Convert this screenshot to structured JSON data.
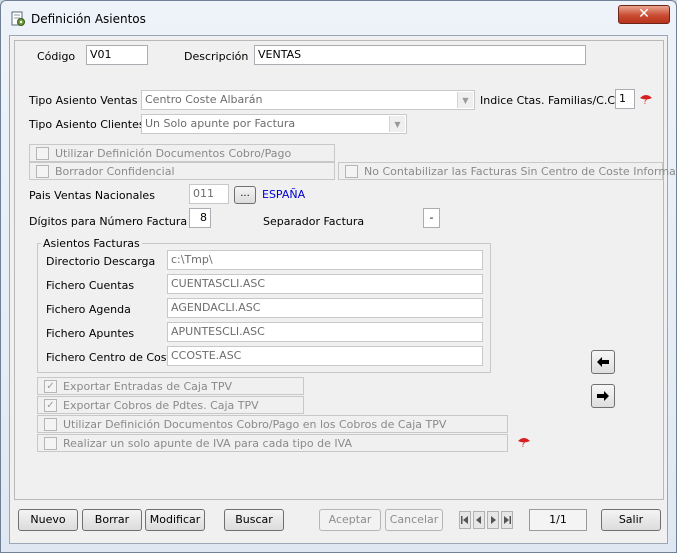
{
  "window": {
    "title": "Definición Asientos",
    "close_label": "✕"
  },
  "form": {
    "codigo_label": "Código",
    "codigo_value": "V01",
    "descripcion_label": "Descripción",
    "descripcion_value": "VENTAS",
    "tipo_ventas_label": "Tipo Asiento Ventas",
    "tipo_ventas_value": "Centro Coste Albarán",
    "indice_label": "Indice Ctas. Familias/C.Cost",
    "indice_value": "1",
    "tipo_clientes_label": "Tipo Asiento Clientes",
    "tipo_clientes_value": "Un Solo apunte por Factura",
    "utilizar_def_label": "Utilizar Definición Documentos Cobro/Pago",
    "borrador_label": "Borrador Confidencial",
    "no_contabilizar_label": "No Contabilizar las Facturas Sin Centro de Coste Informado",
    "pais_label": "Pais Ventas Nacionales",
    "pais_code": "011",
    "pais_browse_label": "...",
    "pais_name": "ESPAÑA",
    "digitos_label": "Dígitos para Número Factura",
    "digitos_value": "8",
    "separador_label": "Separador Factura",
    "separador_value": "-"
  },
  "asientos": {
    "group_title": "Asientos Facturas",
    "rows": [
      {
        "label": "Directorio Descarga",
        "value": "c:\\Tmp\\"
      },
      {
        "label": "Fichero Cuentas",
        "value": "CUENTASCLI.ASC"
      },
      {
        "label": "Fichero Agenda",
        "value": "AGENDACLI.ASC"
      },
      {
        "label": "Fichero Apuntes",
        "value": "APUNTESCLI.ASC"
      },
      {
        "label": "Fichero Centro de Coste",
        "value": "CCOSTE.ASC"
      }
    ]
  },
  "options": {
    "exportar_entradas": "Exportar Entradas de Caja TPV",
    "exportar_cobros": "Exportar Cobros de Pdtes. Caja TPV",
    "utilizar_def_tpv": "Utilizar Definición Documentos Cobro/Pago en los Cobros de Caja TPV",
    "realizar_apunte": "Realizar un solo apunte de IVA para cada tipo de IVA"
  },
  "toolbar": {
    "nuevo": "Nuevo",
    "borrar": "Borrar",
    "modificar": "Modificar",
    "buscar": "Buscar",
    "aceptar": "Aceptar",
    "cancelar": "Cancelar",
    "record_position": "1/1",
    "salir": "Salir"
  },
  "icons": {
    "title_icon": "document-gear-icon",
    "help_icon": "help-question-icon",
    "arrow_left": "arrow-left-icon",
    "arrow_right": "arrow-right-icon"
  },
  "colors": {
    "close_button": "#c94c33",
    "country_name": "#0000d0",
    "help_icon": "#d42020"
  }
}
